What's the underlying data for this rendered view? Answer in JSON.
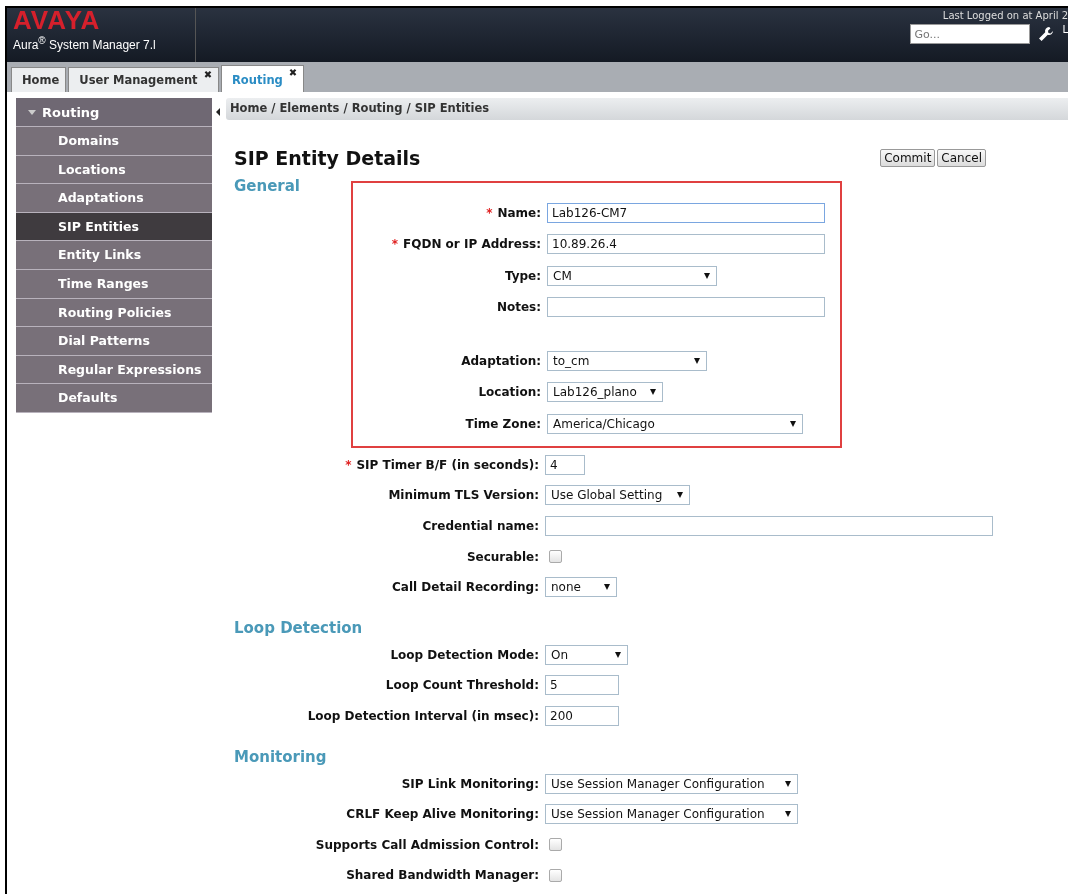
{
  "header": {
    "logo": "AVAYA",
    "product": "Aura$^{®}$ System Manager 7.l",
    "last_logged": "Last Logged on at April 2",
    "search": {
      "placeholder": "Go..."
    },
    "user_link": "L"
  },
  "tabs": [
    {
      "label": "Home",
      "selected": false
    },
    {
      "label": "User Management",
      "selected": false,
      "close": "✖"
    },
    {
      "label": "Routing",
      "selected": true,
      "close": "✖"
    }
  ],
  "sidebar": {
    "title": "Routing",
    "expanded": true,
    "items": [
      {
        "label": "Domains",
        "selected": false
      },
      {
        "label": "Locations",
        "selected": false
      },
      {
        "label": "Adaptations",
        "selected": false
      },
      {
        "label": "SIP Entities",
        "selected": true
      },
      {
        "label": "Entity Links",
        "selected": false
      },
      {
        "label": "Time Ranges",
        "selected": false
      },
      {
        "label": "Routing Policies",
        "selected": false
      },
      {
        "label": "Dial Patterns",
        "selected": false
      },
      {
        "label": "Regular Expressions",
        "selected": false
      },
      {
        "label": "Defaults",
        "selected": false
      }
    ]
  },
  "breadcrumb": "Home / Elements / Routing / SIP Entities",
  "page_title": "SIP Entity Details",
  "buttons": [
    "Commit",
    "Cancel"
  ],
  "sections": [
    {
      "title": "General",
      "highlighted_rows": [
        {
          "kind": "text",
          "mark": "*",
          "label": "Name:",
          "value": "Lab126-CM7",
          "focused": true
        },
        {
          "kind": "text",
          "mark": "*",
          "label": "FQDN or IP Address:",
          "value": "10.89.26.4"
        },
        {
          "kind": "select",
          "label": "Type:",
          "value": "CM"
        },
        {
          "kind": "text",
          "label": "Notes:"
        },
        {
          "kind": "select",
          "label": "Adaptation:",
          "value": "to_cm",
          "gap_before": true
        },
        {
          "kind": "select",
          "label": "Location:",
          "value": "Lab126_plano"
        },
        {
          "kind": "select",
          "label": "Time Zone:",
          "value": "America/Chicago"
        }
      ],
      "rows": [
        {
          "kind": "text",
          "mark": "*",
          "label": "SIP Timer B/F (in seconds):",
          "value": "4"
        },
        {
          "kind": "select",
          "label": "Minimum TLS Version:",
          "value": "Use Global Setting"
        },
        {
          "kind": "text",
          "label": "Credential name:"
        },
        {
          "kind": "checkbox",
          "label": "Securable:",
          "checked": false
        },
        {
          "kind": "select",
          "label": "Call Detail Recording:",
          "value": "none"
        }
      ]
    },
    {
      "title": "Loop Detection",
      "rows": [
        {
          "kind": "select",
          "label": "Loop Detection Mode:",
          "value": "On"
        },
        {
          "kind": "text",
          "label": "Loop Count Threshold:",
          "value": "5"
        },
        {
          "kind": "text",
          "label": "Loop Detection Interval (in msec):",
          "value": "200"
        }
      ]
    },
    {
      "title": "Monitoring",
      "rows": [
        {
          "kind": "select",
          "label": "SIP Link Monitoring:",
          "value": "Use Session Manager Configuration"
        },
        {
          "kind": "select",
          "label": "CRLF Keep Alive Monitoring:",
          "value": "Use Session Manager Configuration"
        },
        {
          "kind": "checkbox",
          "label": "Supports Call Admission Control:",
          "checked": false
        },
        {
          "kind": "checkbox",
          "label": "Shared Bandwidth Manager:",
          "checked": false
        }
      ]
    }
  ]
}
